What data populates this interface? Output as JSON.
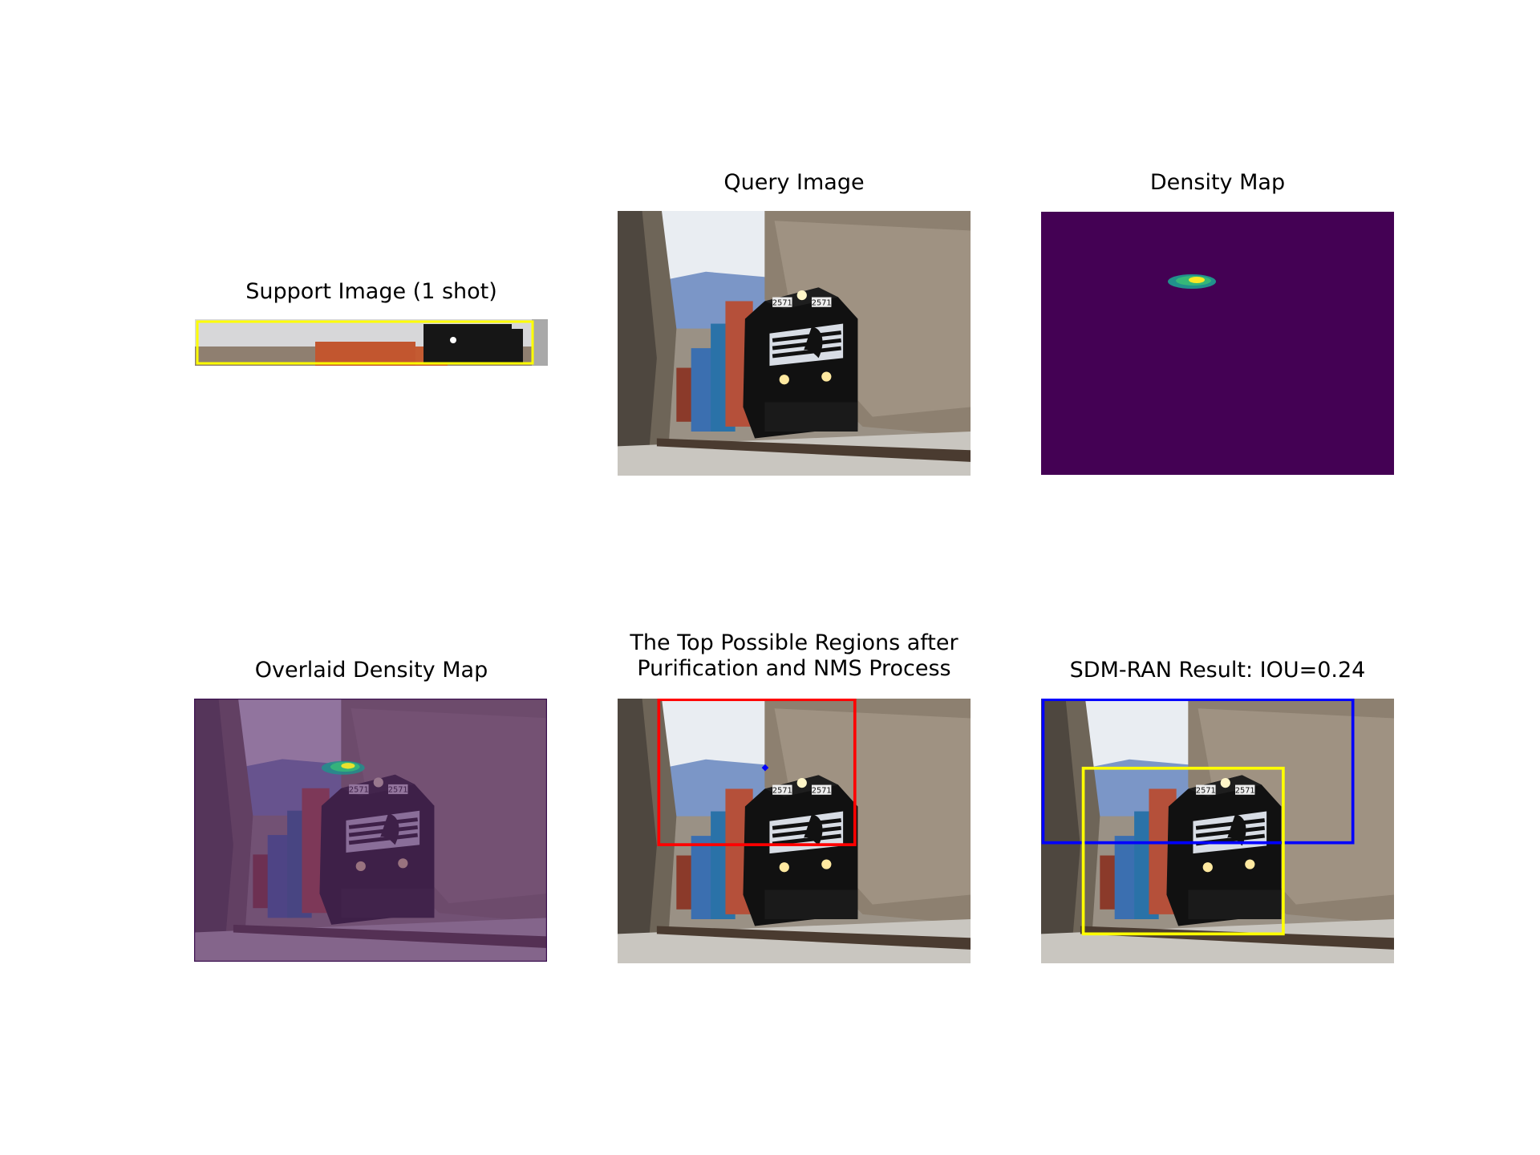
{
  "figure": {
    "panels": [
      {
        "title": "Support Image (1 shot)",
        "kind": "support-photo"
      },
      {
        "title": "Query Image",
        "kind": "query-photo"
      },
      {
        "title": "Density Map",
        "kind": "density-map"
      },
      {
        "title": "Overlaid Density Map",
        "kind": "overlaid-photo"
      },
      {
        "title_line1": "The Top Possible Regions after",
        "title_line2": "Purification and NMS Process",
        "kind": "regions-photo"
      },
      {
        "title": "SDM-RAN Result: IOU=0.24",
        "kind": "result-photo"
      }
    ],
    "locomotive_number": "2571",
    "colors": {
      "density_background": "#440154",
      "density_hot": "#fde725",
      "density_mid": "#35b779",
      "density_low": "#21918c",
      "support_box": "#ffff00",
      "region_box": "#ff0000",
      "region_dot": "#0000ff",
      "predicted_box": "#0000ff",
      "ground_truth_box": "#ffff00",
      "overlay_tint": "#5b2a6b"
    }
  }
}
